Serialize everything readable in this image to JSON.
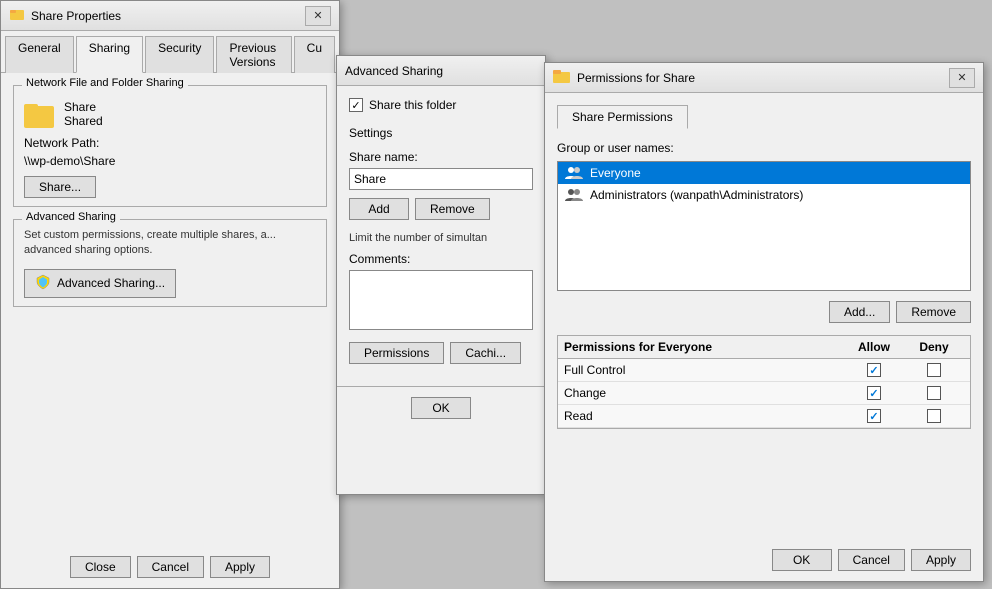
{
  "shareProperties": {
    "title": "Share Properties",
    "tabs": [
      {
        "label": "General",
        "active": false
      },
      {
        "label": "Sharing",
        "active": true
      },
      {
        "label": "Security",
        "active": false
      },
      {
        "label": "Previous Versions",
        "active": false
      },
      {
        "label": "Cu",
        "active": false
      }
    ],
    "networkSharing": {
      "groupTitle": "Network File and Folder Sharing",
      "shareName": "Share",
      "shareStatus": "Shared",
      "networkPathLabel": "Network Path:",
      "networkPath": "\\\\wp-demo\\Share",
      "shareBtn": "Share..."
    },
    "advancedSharing": {
      "groupTitle": "Advanced Sharing",
      "description": "Set custom permissions, create multiple shares, a... advanced sharing options.",
      "advBtn": "Advanced Sharing..."
    },
    "bottomButtons": {
      "close": "Close",
      "cancel": "Cancel",
      "apply": "Apply"
    }
  },
  "advancedSharing": {
    "title": "Advanced Sharing",
    "shareCheckbox": "Share this folder",
    "shareChecked": true,
    "settingsLabel": "Settings",
    "shareNameLabel": "Share name:",
    "shareNameValue": "Share",
    "addBtn": "Add",
    "removeBtn": "Remove",
    "limitLabel": "Limit the number of simultan",
    "commentsLabel": "Comments:",
    "permissionsBtn": "Permissions",
    "cachingBtn": "Cachi...",
    "okBtn": "OK"
  },
  "permissionsWindow": {
    "title": "Permissions for Share",
    "tab": "Share Permissions",
    "groupUserLabel": "Group or user names:",
    "users": [
      {
        "name": "Everyone",
        "selected": true
      },
      {
        "name": "Administrators (wanpath\\Administrators)",
        "selected": false
      }
    ],
    "addBtn": "Add...",
    "removeBtn": "Remove",
    "permissionsLabel": "Permissions for Everyone",
    "columns": {
      "allow": "Allow",
      "deny": "Deny"
    },
    "permissions": [
      {
        "name": "Full Control",
        "allow": true,
        "deny": false
      },
      {
        "name": "Change",
        "allow": true,
        "deny": false
      },
      {
        "name": "Read",
        "allow": true,
        "deny": false
      }
    ],
    "bottomButtons": {
      "ok": "OK",
      "cancel": "Cancel",
      "apply": "Apply"
    },
    "closeBtn": "✕"
  }
}
